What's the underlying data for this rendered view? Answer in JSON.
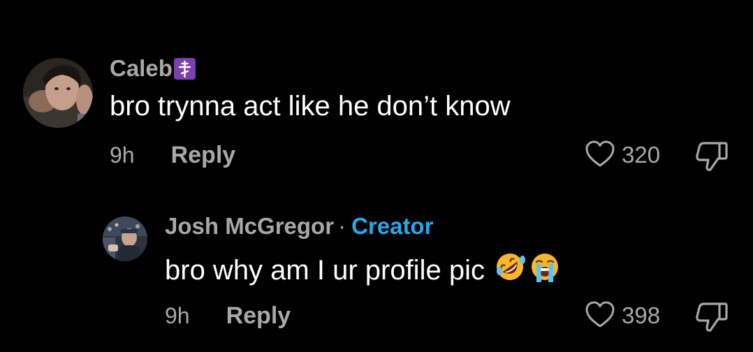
{
  "colors": {
    "background": "#000000",
    "username": "#a8a8a8",
    "body_text": "#ffffff",
    "meta_text": "#a8a8a8",
    "creator_label": "#2aa7e8",
    "badge_bg": "#7b3fb0"
  },
  "comments": [
    {
      "username": "Caleb",
      "badge_icon": "orthodox-cross-icon",
      "text": "bro trynna act like he don’t know",
      "time": "9h",
      "reply_label": "Reply",
      "likes": "320"
    },
    {
      "username": "Josh McGregor",
      "separator": "·",
      "role_label": "Creator",
      "text": "bro why am I ur profile pic",
      "emojis": [
        "rolling-on-floor-laughing-emoji",
        "loudly-crying-emoji"
      ],
      "time": "9h",
      "reply_label": "Reply",
      "likes": "398"
    }
  ]
}
